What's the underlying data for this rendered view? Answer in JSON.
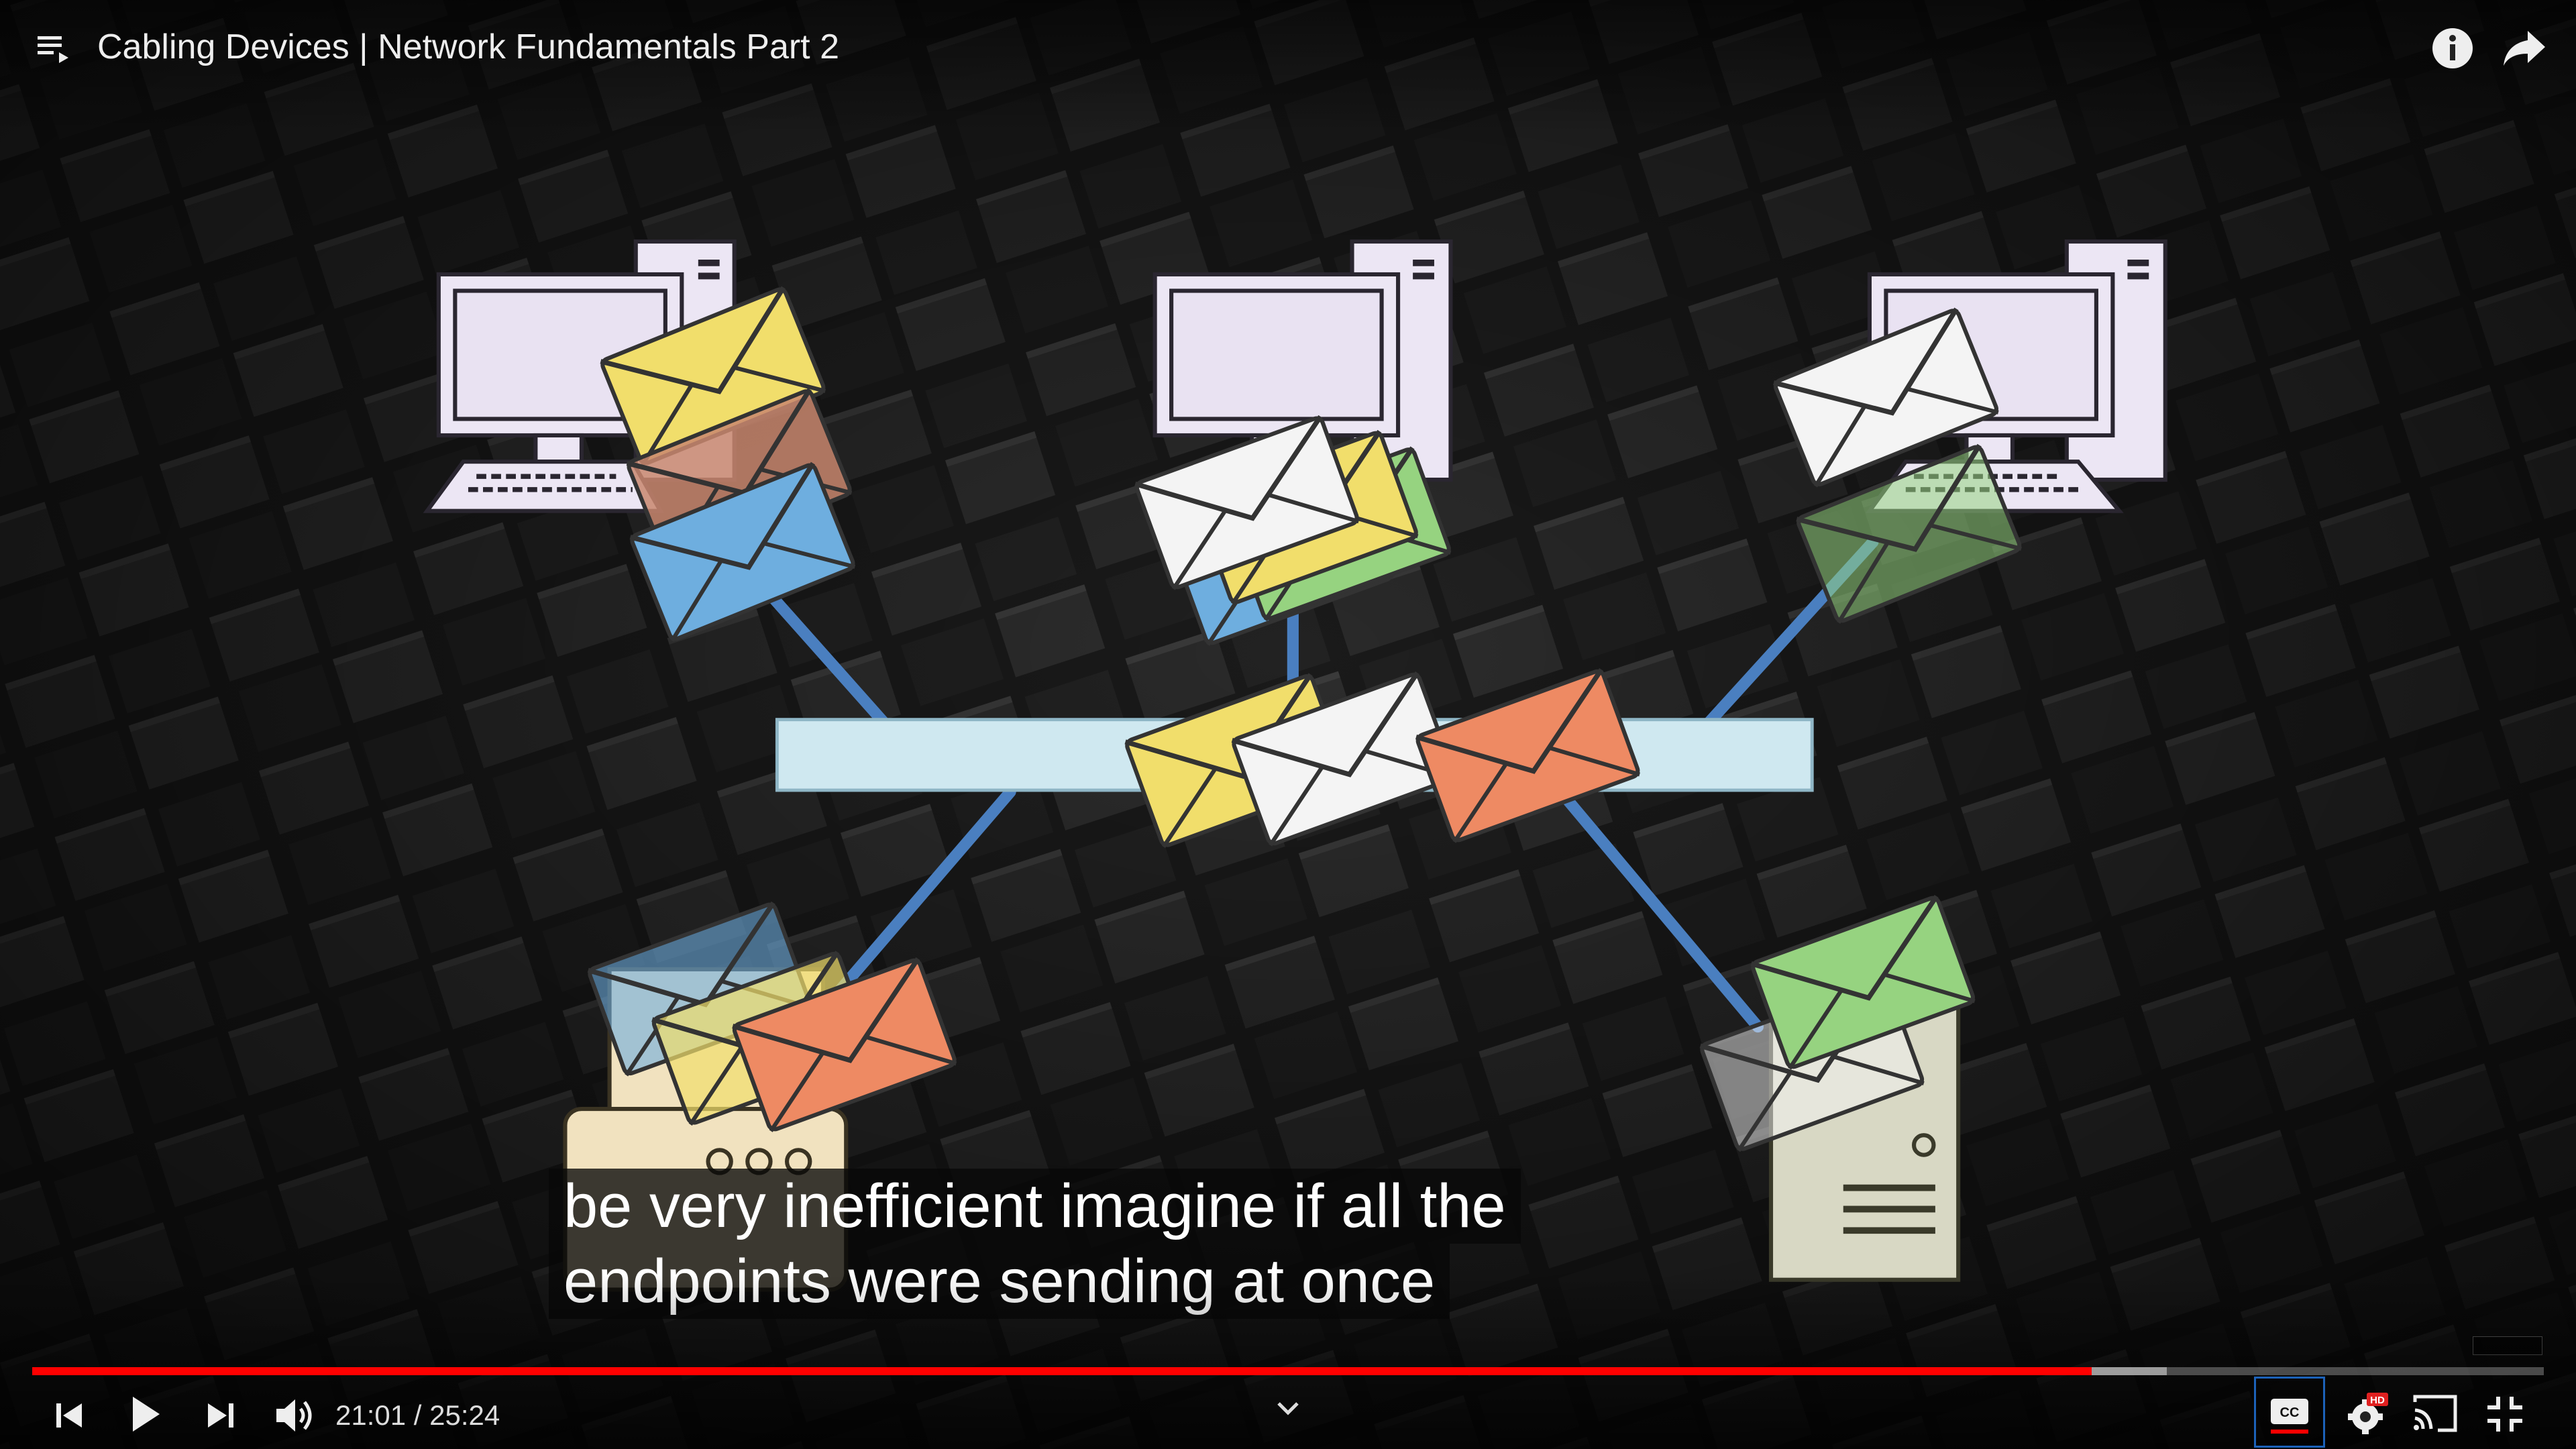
{
  "video": {
    "title": "Cabling Devices | Network Fundamentals Part 2",
    "captions": [
      "be very inefficient imagine if all the",
      "endpoints were sending at once"
    ],
    "time_display": "21:01 / 25:24",
    "progress": {
      "played_fraction": 0.82,
      "buffered_fraction": 0.85
    }
  },
  "icons": {
    "playlist": "playlist-icon",
    "info": "info-icon",
    "share": "share-icon",
    "previous": "skip-previous-icon",
    "play": "play-icon",
    "next": "skip-next-icon",
    "volume": "volume-icon",
    "chevron": "chevron-down-icon",
    "captions": "closed-captions-icon",
    "settings": "settings-gear-icon",
    "hd_badge": "HD",
    "cast": "cast-icon",
    "fullscreen": "exit-fullscreen-icon"
  },
  "colors": {
    "progress_played": "#ff0000",
    "cable": "#4a7fc0",
    "switch": "#cfe8f0",
    "device_fill": "#ece6f4",
    "printer_fill": "#f1e2bf",
    "server_fill": "#d8d8c4",
    "envelope_yellow": "#f1de6b",
    "envelope_blue": "#6eaedf",
    "envelope_white": "#f4f4f4",
    "envelope_orange": "#ee8a63",
    "envelope_green": "#96d380",
    "envelope_brown": "#c9876e",
    "cc_border": "#1c62b9",
    "hd_badge": "#e02020"
  }
}
